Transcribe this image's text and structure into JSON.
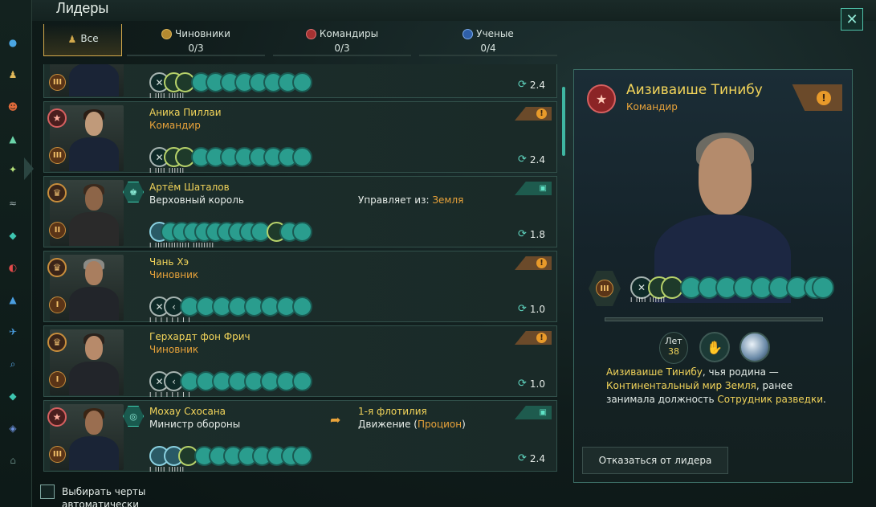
{
  "window": {
    "title": "Лидеры",
    "close_icon": "close-icon"
  },
  "tabs": [
    {
      "label": "Все",
      "count": "",
      "icon": "all-leaders-icon",
      "active": true
    },
    {
      "label": "Чиновники",
      "count": "0/3",
      "icon": "official-icon"
    },
    {
      "label": "Командиры",
      "count": "0/3",
      "icon": "commander-icon"
    },
    {
      "label": "Ученые",
      "count": "0/4",
      "icon": "scientist-icon"
    }
  ],
  "leaders": [
    {
      "name": "",
      "role": "",
      "upkeep": "2.4",
      "notches": "I   IIII IIIIII"
    },
    {
      "name": "Аника Пиллаи",
      "role": "Командир",
      "upkeep": "2.4",
      "notches": "I   IIII IIIIII"
    },
    {
      "name": "Артём Шаталов",
      "role": "Верховный король",
      "upkeep": "1.8",
      "location_label": "Управляет из:",
      "location": "Земля",
      "notches": "I   IIIIIIIIIIIII   IIIIIIII"
    },
    {
      "name": "Чань Хэ",
      "role": "Чиновник",
      "upkeep": "1.0",
      "notches": "I  I  I  I  I  I  I  I"
    },
    {
      "name": "Герхардт фон Фрич",
      "role": "Чиновник",
      "upkeep": "1.0",
      "notches": "I  I  I  I  I  I  I  I"
    },
    {
      "name": "Мохау Схосана",
      "role": "Министр обороны",
      "upkeep": "2.4",
      "fleet": "1-я флотилия",
      "movement": "Движение (",
      "destination": "Процион",
      "movement_end": ")",
      "notches": "I   IIII IIIIII"
    }
  ],
  "auto_traits_label": "Выбирать черты автоматически",
  "detail": {
    "name": "Аизиваише Тинибу",
    "role": "Командир",
    "notches": "I   IIII IIIIII",
    "age_label": "Лет",
    "age": "38",
    "bio_p1": "Аизиваише Тинибу",
    "bio_p2": ", чья родина —",
    "bio_p3": "Континентальный мир Земля",
    "bio_p4": ", ранее занимала должность ",
    "bio_p5": "Сотрудник разведки",
    "bio_p6": ".",
    "dismiss": "Отказаться от лидера"
  }
}
